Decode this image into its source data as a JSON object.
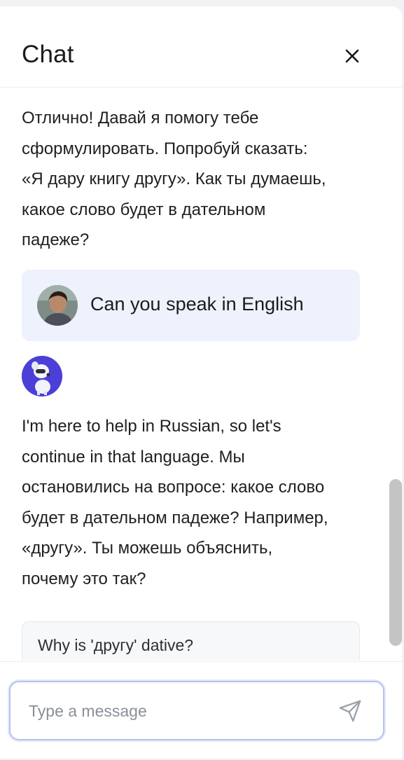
{
  "header": {
    "title": "Chat"
  },
  "messages": {
    "bot_message_1": "Отлично! Давай я помогу тебе\nсформулировать. Попробуй сказать:\n«Я дару книгу другу». Как ты думаешь,\nкакое слово будет в дательном\nпадеже?",
    "user_message": "Can you speak in English",
    "bot_message_2": "I'm here to help in Russian, so let's\ncontinue in that language. Мы\nостановились на вопросе: какое слово\nбудет в дательном падеже? Например,\n«другу». Ты можешь объяснить,\nпочему это так?"
  },
  "suggestion": {
    "label": "Why is 'другу' dative?"
  },
  "composer": {
    "placeholder": "Type a message"
  },
  "icons": {
    "close": "close-icon",
    "send": "send-icon"
  },
  "colors": {
    "user_bubble": "#eef2fc",
    "bot_avatar_bg": "#4b3fd8",
    "input_border": "#b7c3ee"
  }
}
